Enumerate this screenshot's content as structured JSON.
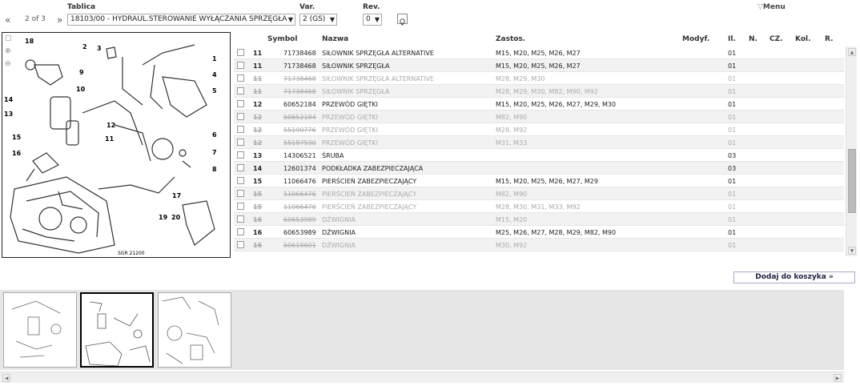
{
  "header": {
    "labels": {
      "tablica": "Tablica",
      "var": "Var.",
      "rev": "Rev.",
      "menu": "Menu"
    },
    "pager": {
      "first": "«",
      "page_text": "2 of 3",
      "next": "»"
    },
    "tablica_value": "18103/00 - HYDRAUL.STEROWANIE WYŁĄCZANIA SPRZĘGŁA",
    "var_value": "2 (GS)",
    "rev_value": "0",
    "menu_icon": "triangle-down-icon",
    "bulb_icon": "lightbulb-icon"
  },
  "diagram": {
    "callouts": [
      "18",
      "2",
      "3",
      "1",
      "4",
      "5",
      "9",
      "10",
      "14",
      "13",
      "11",
      "12",
      "6",
      "7",
      "8",
      "15",
      "16",
      "17",
      "19",
      "20"
    ],
    "caption": "SGR 21200"
  },
  "table": {
    "columns": [
      "Symbol",
      "Nazwa",
      "Zastos.",
      "Modyf.",
      "Il.",
      "N.",
      "CZ.",
      "Kol.",
      "R."
    ],
    "rows": [
      {
        "no": "11",
        "symbol": "71738468",
        "name": "SIŁOWNIK SPRZĘGŁA ALTERNATIVE",
        "zastos": "M15, M20, M25, M26, M27",
        "il": "01",
        "active": true
      },
      {
        "no": "11",
        "symbol": "71738468",
        "name": "SIŁOWNIK SPRZĘGŁA",
        "zastos": "M15, M20, M25, M26, M27",
        "il": "01",
        "active": true
      },
      {
        "no": "11",
        "symbol": "71738468",
        "name": "SIŁOWNIK SPRZĘGŁA ALTERNATIVE",
        "zastos": "M28, M29, M30",
        "il": "01",
        "active": false
      },
      {
        "no": "11",
        "symbol": "71738468",
        "name": "SIŁOWNIK SPRZĘGŁA",
        "zastos": "M28, M29, M30, M82, M90, M92",
        "il": "01",
        "active": false
      },
      {
        "no": "12",
        "symbol": "60652184",
        "name": "PRZEWÓD GIĘTKI",
        "zastos": "M15, M20, M25, M26, M27, M29, M30",
        "il": "01",
        "active": true
      },
      {
        "no": "12",
        "symbol": "60652184",
        "name": "PRZEWÓD GIĘTKI",
        "zastos": "M82, M90",
        "il": "01",
        "active": false
      },
      {
        "no": "12",
        "symbol": "55190776",
        "name": "PRZEWÓD GIĘTKI",
        "zastos": "M28, M92",
        "il": "01",
        "active": false
      },
      {
        "no": "12",
        "symbol": "55187530",
        "name": "PRZEWÓD GIĘTKI",
        "zastos": "M31, M33",
        "il": "01",
        "active": false
      },
      {
        "no": "13",
        "symbol": "14306521",
        "name": "ŚRUBA",
        "zastos": "",
        "il": "03",
        "active": true
      },
      {
        "no": "14",
        "symbol": "12601374",
        "name": "PODKŁADKA ZABEZPIECZAJĄCA",
        "zastos": "",
        "il": "03",
        "active": true
      },
      {
        "no": "15",
        "symbol": "11066476",
        "name": "PIERŚCIEŃ ZABEZPIECZAJĄCY",
        "zastos": "M15, M20, M25, M26, M27, M29",
        "il": "01",
        "active": true
      },
      {
        "no": "15",
        "symbol": "11066476",
        "name": "PIERŚCIEŃ ZABEZPIECZAJĄCY",
        "zastos": "M82, M90",
        "il": "01",
        "active": false
      },
      {
        "no": "15",
        "symbol": "11066476",
        "name": "PIERŚCIEŃ ZABEZPIECZAJĄCY",
        "zastos": "M28, M30, M31, M33, M92",
        "il": "01",
        "active": false
      },
      {
        "no": "16",
        "symbol": "60653989",
        "name": "DŹWIGNIA",
        "zastos": "M15, M20",
        "il": "01",
        "active": false
      },
      {
        "no": "16",
        "symbol": "60653989",
        "name": "DŹWIGNIA",
        "zastos": "M25, M26, M27, M28, M29, M82, M90",
        "il": "01",
        "active": true
      },
      {
        "no": "16",
        "symbol": "60618601",
        "name": "DŹWIGNIA",
        "zastos": "M30, M92",
        "il": "01",
        "active": false
      }
    ]
  },
  "add_to_cart": "Dodaj do koszyka  »"
}
